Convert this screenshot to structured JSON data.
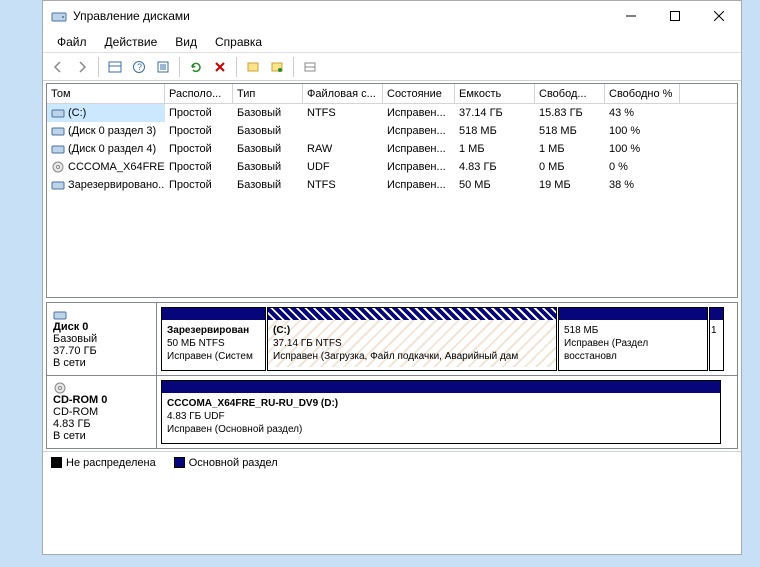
{
  "title": "Управление дисками",
  "menu": {
    "file": "Файл",
    "action": "Действие",
    "view": "Вид",
    "help": "Справка"
  },
  "columns": [
    "Том",
    "Располо...",
    "Тип",
    "Файловая с...",
    "Состояние",
    "Емкость",
    "Свобод...",
    "Свободно %"
  ],
  "rows": [
    {
      "vol": "(C:)",
      "layout": "Простой",
      "type": "Базовый",
      "fs": "NTFS",
      "state": "Исправен...",
      "cap": "37.14 ГБ",
      "free": "15.83 ГБ",
      "pct": "43 %",
      "ico": "hdd",
      "sel": true
    },
    {
      "vol": "(Диск 0 раздел 3)",
      "layout": "Простой",
      "type": "Базовый",
      "fs": "",
      "state": "Исправен...",
      "cap": "518 МБ",
      "free": "518 МБ",
      "pct": "100 %",
      "ico": "hdd"
    },
    {
      "vol": "(Диск 0 раздел 4)",
      "layout": "Простой",
      "type": "Базовый",
      "fs": "RAW",
      "state": "Исправен...",
      "cap": "1 МБ",
      "free": "1 МБ",
      "pct": "100 %",
      "ico": "hdd"
    },
    {
      "vol": "CCCOMA_X64FRE...",
      "layout": "Простой",
      "type": "Базовый",
      "fs": "UDF",
      "state": "Исправен...",
      "cap": "4.83 ГБ",
      "free": "0 МБ",
      "pct": "0 %",
      "ico": "cd"
    },
    {
      "vol": "Зарезервировано...",
      "layout": "Простой",
      "type": "Базовый",
      "fs": "NTFS",
      "state": "Исправен...",
      "cap": "50 МБ",
      "free": "19 МБ",
      "pct": "38 %",
      "ico": "hdd"
    }
  ],
  "disk0": {
    "name": "Диск 0",
    "type": "Базовый",
    "size": "37.70 ГБ",
    "status": "В сети",
    "p1": {
      "name": "Зарезервирован",
      "fs": "50 МБ NTFS",
      "st": "Исправен (Систем"
    },
    "p2": {
      "name": "(C:)",
      "fs": "37.14 ГБ NTFS",
      "st": "Исправен (Загрузка, Файл подкачки, Аварийный дам"
    },
    "p3": {
      "name": "",
      "fs": "518 МБ",
      "st": "Исправен (Раздел восстановл"
    },
    "p4": {
      "name": "",
      "fs": "1",
      "st": ""
    }
  },
  "cd0": {
    "name": "CD-ROM 0",
    "type": "CD-ROM",
    "size": "4.83 ГБ",
    "status": "В сети",
    "p": {
      "name": "CCCOMA_X64FRE_RU-RU_DV9  (D:)",
      "fs": "4.83 ГБ UDF",
      "st": "Исправен (Основной раздел)"
    }
  },
  "legend": {
    "unalloc": "Не распределена",
    "primary": "Основной раздел"
  }
}
